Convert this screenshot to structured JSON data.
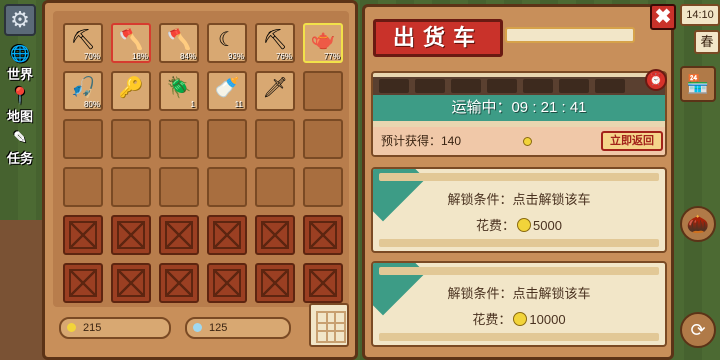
{
  "hud_left": {
    "buttons": [
      {
        "label": "世界",
        "icon": "globe-icon"
      },
      {
        "label": "地图",
        "icon": "map-pin-icon"
      },
      {
        "label": "任务",
        "icon": "quest-icon"
      }
    ]
  },
  "inventory": {
    "slots": [
      {
        "icon": "pickaxe-icon",
        "glyph": "⛏",
        "pct": "70%",
        "state": "filled"
      },
      {
        "icon": "axe-icon",
        "glyph": "🪓",
        "pct": "18%",
        "state": "sel"
      },
      {
        "icon": "hoe-icon",
        "glyph": "🪓",
        "pct": "84%",
        "state": "filled"
      },
      {
        "icon": "sickle-icon",
        "glyph": "☾",
        "pct": "93%",
        "state": "filled"
      },
      {
        "icon": "shovel-icon",
        "glyph": "⛏",
        "pct": "76%",
        "state": "filled"
      },
      {
        "icon": "watering-can-icon",
        "glyph": "🫖",
        "pct": "77%",
        "state": "hl"
      },
      {
        "icon": "fishing-rod-icon",
        "glyph": "🎣",
        "pct": "80%",
        "state": "filled"
      },
      {
        "icon": "key-icon",
        "glyph": "🔑",
        "count": "",
        "state": "filled"
      },
      {
        "icon": "beetle-icon",
        "glyph": "🪲",
        "count": "1",
        "state": "filled"
      },
      {
        "icon": "milk-bottle-icon",
        "glyph": "🍼",
        "count": "11",
        "state": "filled"
      },
      {
        "icon": "wooden-sword-icon",
        "glyph": "🗡",
        "count": "",
        "state": "filled"
      }
    ],
    "coins": "215",
    "gems": "125"
  },
  "shipping": {
    "title": "出货车",
    "transit_label": "运输中：",
    "transit_time": "09 : 21 : 41",
    "earn_label": "预计获得：140",
    "recall_label": "立即返回",
    "locked": [
      {
        "condition": "解锁条件：点击解锁该车",
        "fee_label": "花费：",
        "fee": "5000"
      },
      {
        "condition": "解锁条件：点击解锁该车",
        "fee_label": "花费：",
        "fee": "10000"
      }
    ]
  },
  "hud_right": {
    "time": "14:10",
    "season": "春"
  },
  "colors": {
    "accent_red": "#c9322a",
    "transit_teal": "#3d9c86",
    "coin": "#f2d43a",
    "gem": "#9fd8f0"
  }
}
